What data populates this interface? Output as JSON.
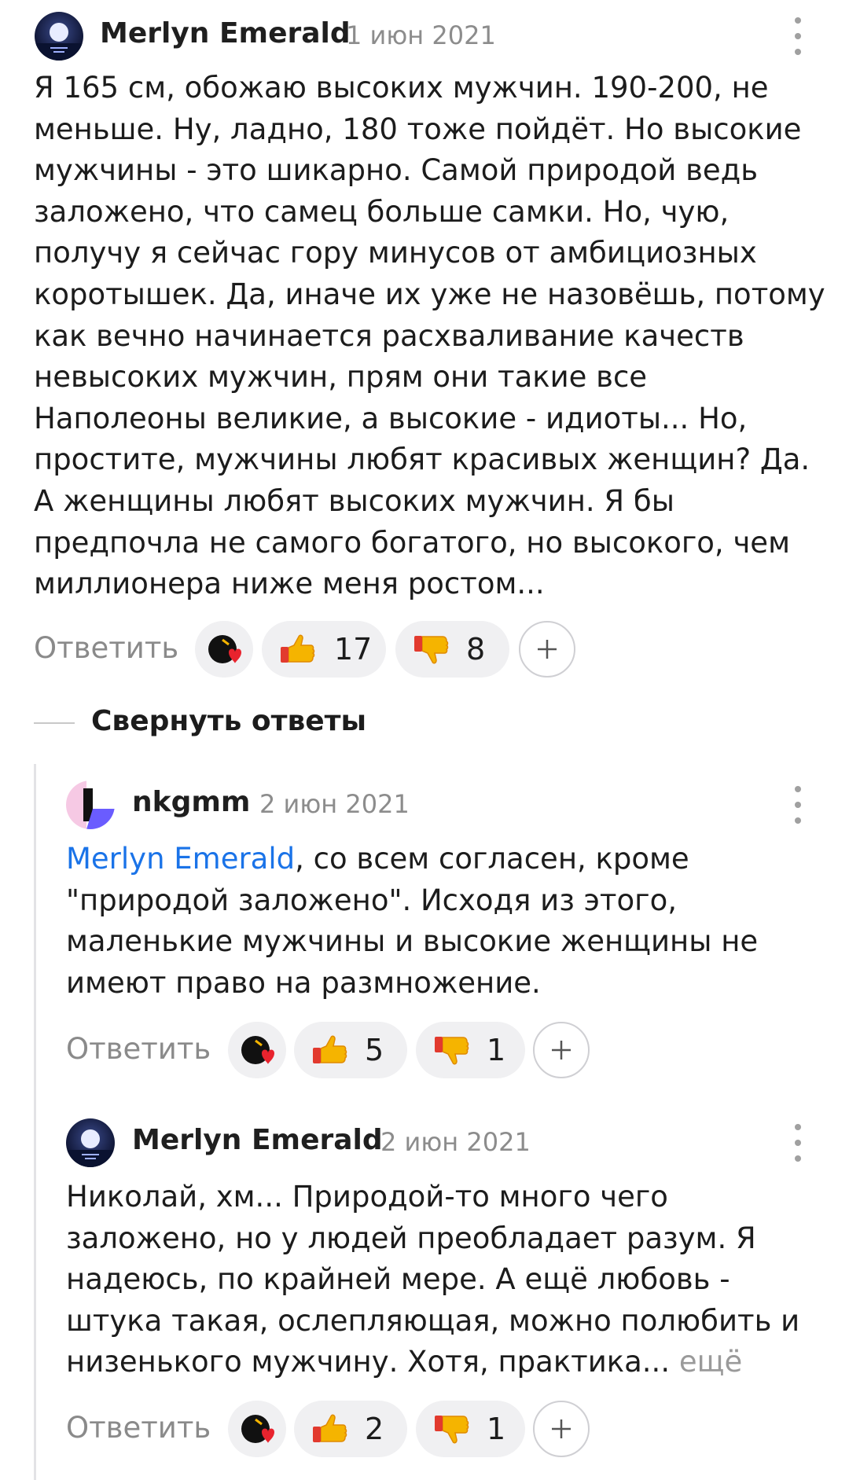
{
  "comments": [
    {
      "author": "Merlyn Emerald",
      "date": "1 июн 2021",
      "lines": [
        "Я 165 см, обожаю высоких мужчин. 190-200, не",
        "меньше. Ну, ладно, 180 тоже пойдёт. Но высокие",
        "мужчины - это шикарно. Самой природой ведь",
        "заложено, что самец больше самки. Но, чую,",
        "получу я сейчас гору минусов от амбициозных",
        "коротышек. Да, иначе их уже не назовёшь, потому",
        "как вечно начинается расхваливание качеств",
        "невысоких мужчин, прям они такие все",
        "Наполеоны великие, а высокие - идиоты... Но,",
        "простите, мужчины любят красивых женщин? Да.",
        "А женщины любят высоких мужчин. Я бы",
        "предпочла не самого богатого, но высокого, чем",
        "миллионера ниже меня ростом..."
      ],
      "reply_label": "Ответить",
      "likes": "17",
      "dislikes": "8"
    },
    {
      "author": "nkgmm",
      "date": "2 июн 2021",
      "mention": "Merlyn Emerald",
      "lines": [
        ", со всем согласен, кроме",
        "\"природой заложено\". Исходя из этого,",
        "маленькие мужчины и высокие женщины не",
        "имеют право на размножение."
      ],
      "reply_label": "Ответить",
      "likes": "5",
      "dislikes": "1"
    },
    {
      "author": "Merlyn Emerald",
      "date": "2 июн 2021",
      "lines": [
        "Николай, хм... Природой-то много чего",
        "заложено, но у людей преобладает разум. Я",
        "надеюсь, по крайней мере. А ещё любовь -",
        "штука такая, ослепляющая, можно полюбить и",
        "низенького мужчину. Хотя, практика..."
      ],
      "more_label": "ещё",
      "reply_label": "Ответить",
      "likes": "2",
      "dislikes": "1"
    }
  ],
  "collapse_label": "Свернуть ответы",
  "icons": {
    "avatar_moon": "moon-night-avatar",
    "avatar_nkgmm": "abstract-avatar",
    "reaction_heart": "heart-reaction-icon",
    "like": "thumbs-up-icon",
    "dislike": "thumbs-down-icon",
    "add_reaction": "plus-icon",
    "menu": "more-vertical-icon"
  },
  "colors": {
    "mention": "#1a73e8",
    "pill_bg": "#f0f0f2",
    "muted_text": "#8a8a8a"
  }
}
